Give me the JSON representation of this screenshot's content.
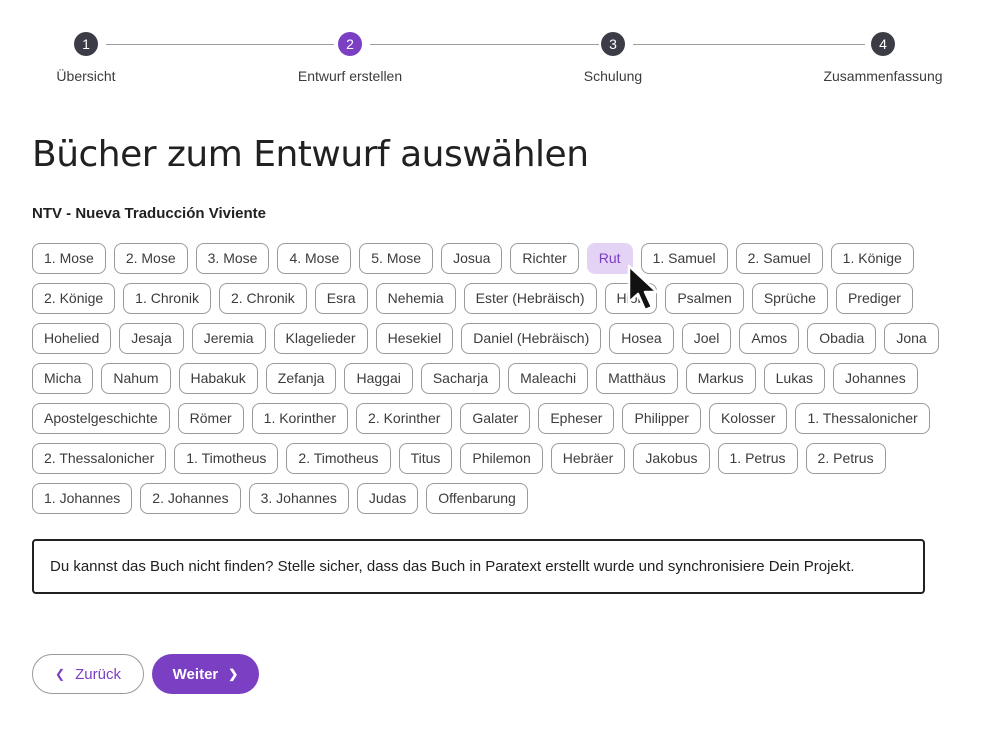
{
  "stepper": {
    "steps": [
      {
        "number": "1",
        "label": "Übersicht"
      },
      {
        "number": "2",
        "label": "Entwurf erstellen"
      },
      {
        "number": "3",
        "label": "Schulung"
      },
      {
        "number": "4",
        "label": "Zusammenfassung"
      }
    ],
    "active_step": 2
  },
  "page_title": "Bücher zum Entwurf auswählen",
  "project_name": "NTV - Nueva Traducción Viviente",
  "books": [
    "1. Mose",
    "2. Mose",
    "3. Mose",
    "4. Mose",
    "5. Mose",
    "Josua",
    "Richter",
    "Rut",
    "1. Samuel",
    "2. Samuel",
    "1. Könige",
    "2. Könige",
    "1. Chronik",
    "2. Chronik",
    "Esra",
    "Nehemia",
    "Ester (Hebräisch)",
    "Hiob",
    "Psalmen",
    "Sprüche",
    "Prediger",
    "Hohelied",
    "Jesaja",
    "Jeremia",
    "Klagelieder",
    "Hesekiel",
    "Daniel (Hebräisch)",
    "Hosea",
    "Joel",
    "Amos",
    "Obadia",
    "Jona",
    "Micha",
    "Nahum",
    "Habakuk",
    "Zefanja",
    "Haggai",
    "Sacharja",
    "Maleachi",
    "Matthäus",
    "Markus",
    "Lukas",
    "Johannes",
    "Apostelgeschichte",
    "Römer",
    "1. Korinther",
    "2. Korinther",
    "Galater",
    "Epheser",
    "Philipper",
    "Kolosser",
    "1. Thessalonicher",
    "2. Thessalonicher",
    "1. Timotheus",
    "2. Timotheus",
    "Titus",
    "Philemon",
    "Hebräer",
    "Jakobus",
    "1. Petrus",
    "2. Petrus",
    "1. Johannes",
    "2. Johannes",
    "3. Johannes",
    "Judas",
    "Offenbarung"
  ],
  "hovered_book": "Rut",
  "info_text": "Du kannst das Buch nicht finden? Stelle sicher, dass das Buch in Paratext erstellt wurde und synchronisiere Dein Projekt.",
  "buttons": {
    "back": "Zurück",
    "next": "Weiter"
  },
  "icons": {
    "back": "chevron-left-icon",
    "next": "chevron-right-icon",
    "cursor": "mouse-pointer-icon"
  },
  "colors": {
    "accent": "#7b3fc4",
    "hover_chip_bg": "#e4d3f5",
    "step_inactive": "#3c3c46"
  }
}
